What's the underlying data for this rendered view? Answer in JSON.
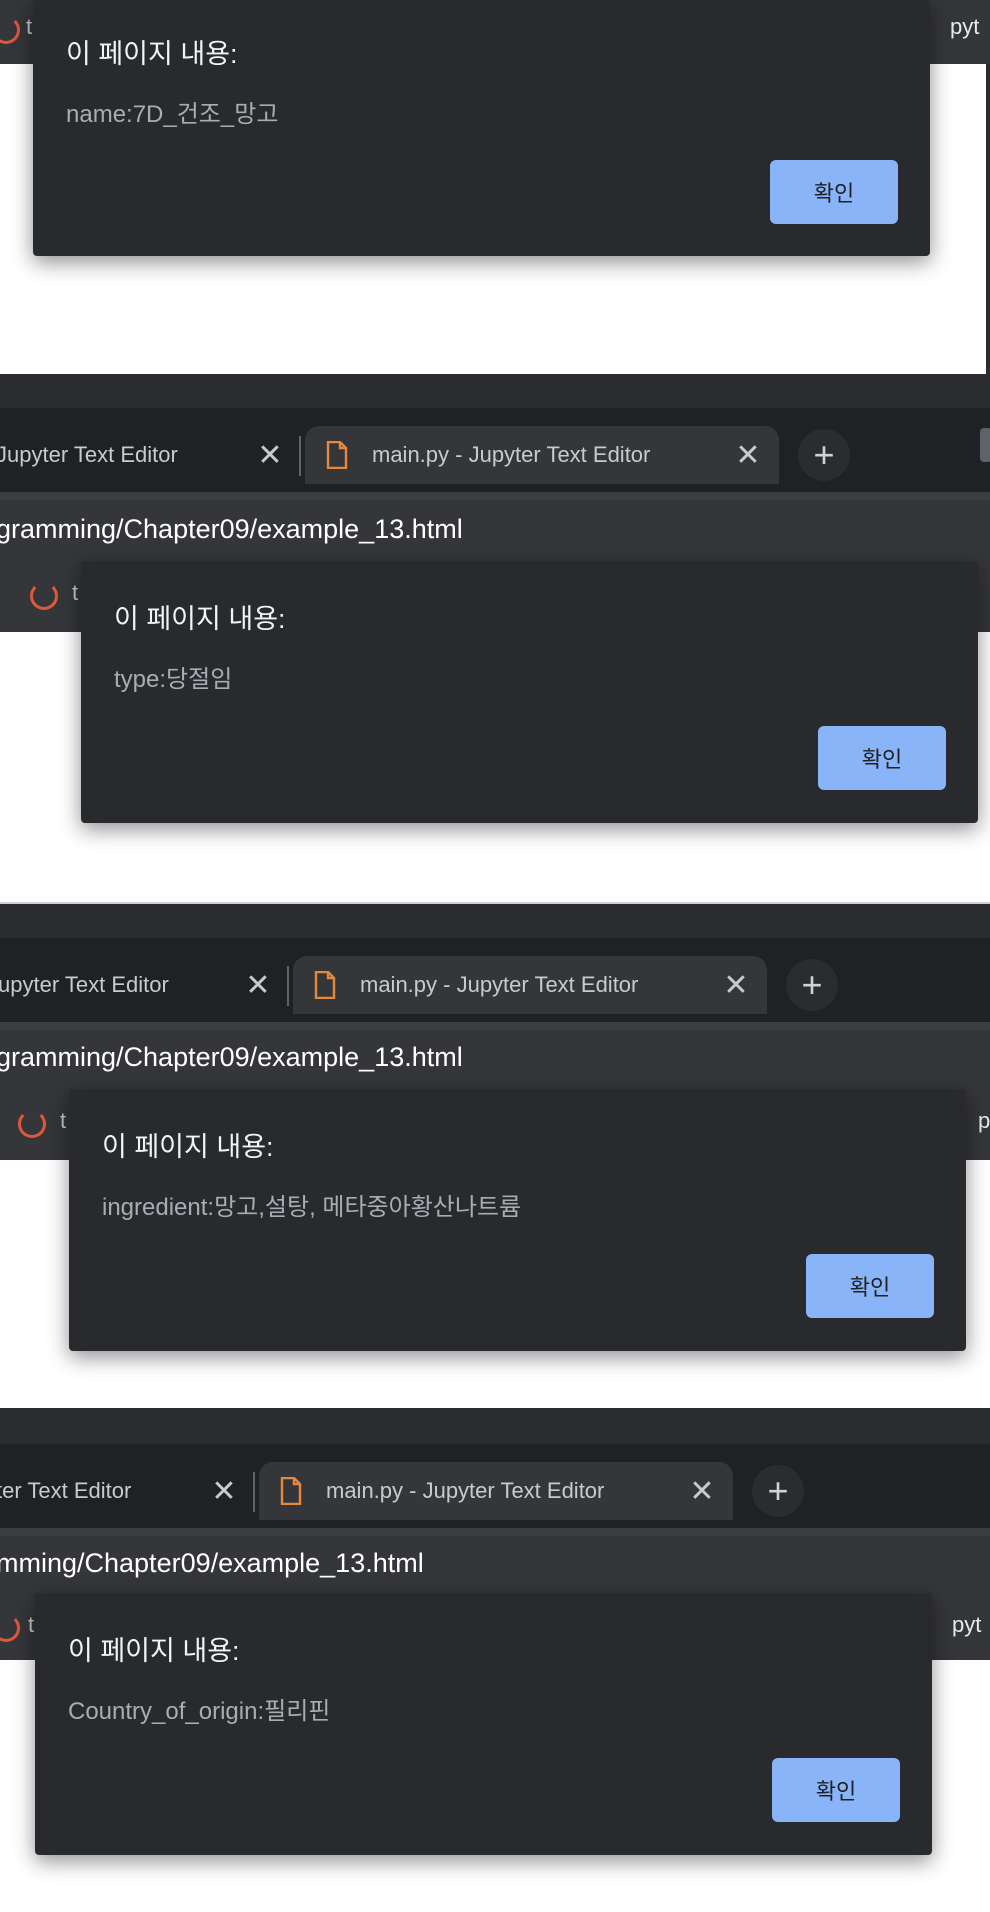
{
  "dialogs": [
    {
      "title": "이 페이지 내용:",
      "message": "name:7D_건조_망고",
      "ok_label": "확인"
    },
    {
      "title": "이 페이지 내용:",
      "message": "type:당절임",
      "ok_label": "확인"
    },
    {
      "title": "이 페이지 내용:",
      "message": "ingredient:망고,설탕, 메타중아황산나트륨",
      "ok_label": "확인"
    },
    {
      "title": "이 페이지 내용:",
      "message": "Country_of_origin:필리핀",
      "ok_label": "확인"
    }
  ],
  "frames": [
    {
      "tab1_label": "Jupyter Text Editor",
      "tab2_label": "main.py - Jupyter Text Editor",
      "url": "gramming/Chapter09/example_13.html"
    },
    {
      "tab1_label": "upyter Text Editor",
      "tab2_label": "main.py - Jupyter Text Editor",
      "url": "gramming/Chapter09/example_13.html"
    },
    {
      "tab1_label": "ter Text Editor",
      "tab2_label": "main.py - Jupyter Text Editor",
      "url": "mming/Chapter09/example_13.html"
    }
  ],
  "edge": {
    "bookmark_t": "t",
    "right_pyt": "pyt",
    "right_p": "p"
  },
  "colors": {
    "dialog_bg": "#292a2d",
    "button": "#8ab4f8",
    "accent_icon": "#e8883a"
  }
}
